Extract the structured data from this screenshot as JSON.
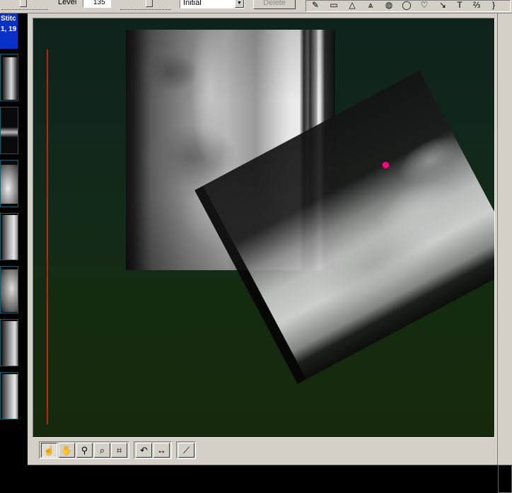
{
  "toolbar": {
    "level_label": "Level",
    "level_value": "135",
    "preset_value": "Initial",
    "delete_label": "Delete",
    "draw_tools": [
      {
        "icon": "pencil-icon",
        "glyph": "✎"
      },
      {
        "icon": "ruler-icon",
        "glyph": "▭"
      },
      {
        "icon": "angle-icon",
        "glyph": "△"
      },
      {
        "icon": "cobb-angle-icon",
        "glyph": "⩓"
      },
      {
        "icon": "hatch-ellipse-icon",
        "glyph": "◍"
      },
      {
        "icon": "ellipse-icon",
        "glyph": "◯"
      },
      {
        "icon": "freehand-region-icon",
        "glyph": "♡"
      },
      {
        "icon": "arrow-icon",
        "glyph": "↘"
      },
      {
        "icon": "text-icon",
        "glyph": "T"
      },
      {
        "icon": "numbering-icon",
        "glyph": "⅔"
      },
      {
        "icon": "bracket-icon",
        "glyph": "}"
      }
    ]
  },
  "sidebar": {
    "active_tab_line1": "Stitc",
    "active_tab_line2": "1, 19"
  },
  "bottom_tools": [
    {
      "icon": "select-hand-icon",
      "glyph": "☝"
    },
    {
      "icon": "pan-hand-icon",
      "glyph": "✋"
    },
    {
      "icon": "pin-icon",
      "glyph": "⚲"
    },
    {
      "icon": "zoom-icon",
      "glyph": "⌕"
    },
    {
      "icon": "crop-icon",
      "glyph": "⌗"
    },
    {
      "icon": "rotate-icon",
      "glyph": "↶"
    },
    {
      "icon": "flip-horizontal-icon",
      "glyph": "↔"
    },
    {
      "icon": "wand-icon",
      "glyph": "⟋"
    }
  ],
  "colors": {
    "marker": "#e8107a",
    "ruler": "#b42814",
    "tab_highlight": "#0a30c8"
  }
}
